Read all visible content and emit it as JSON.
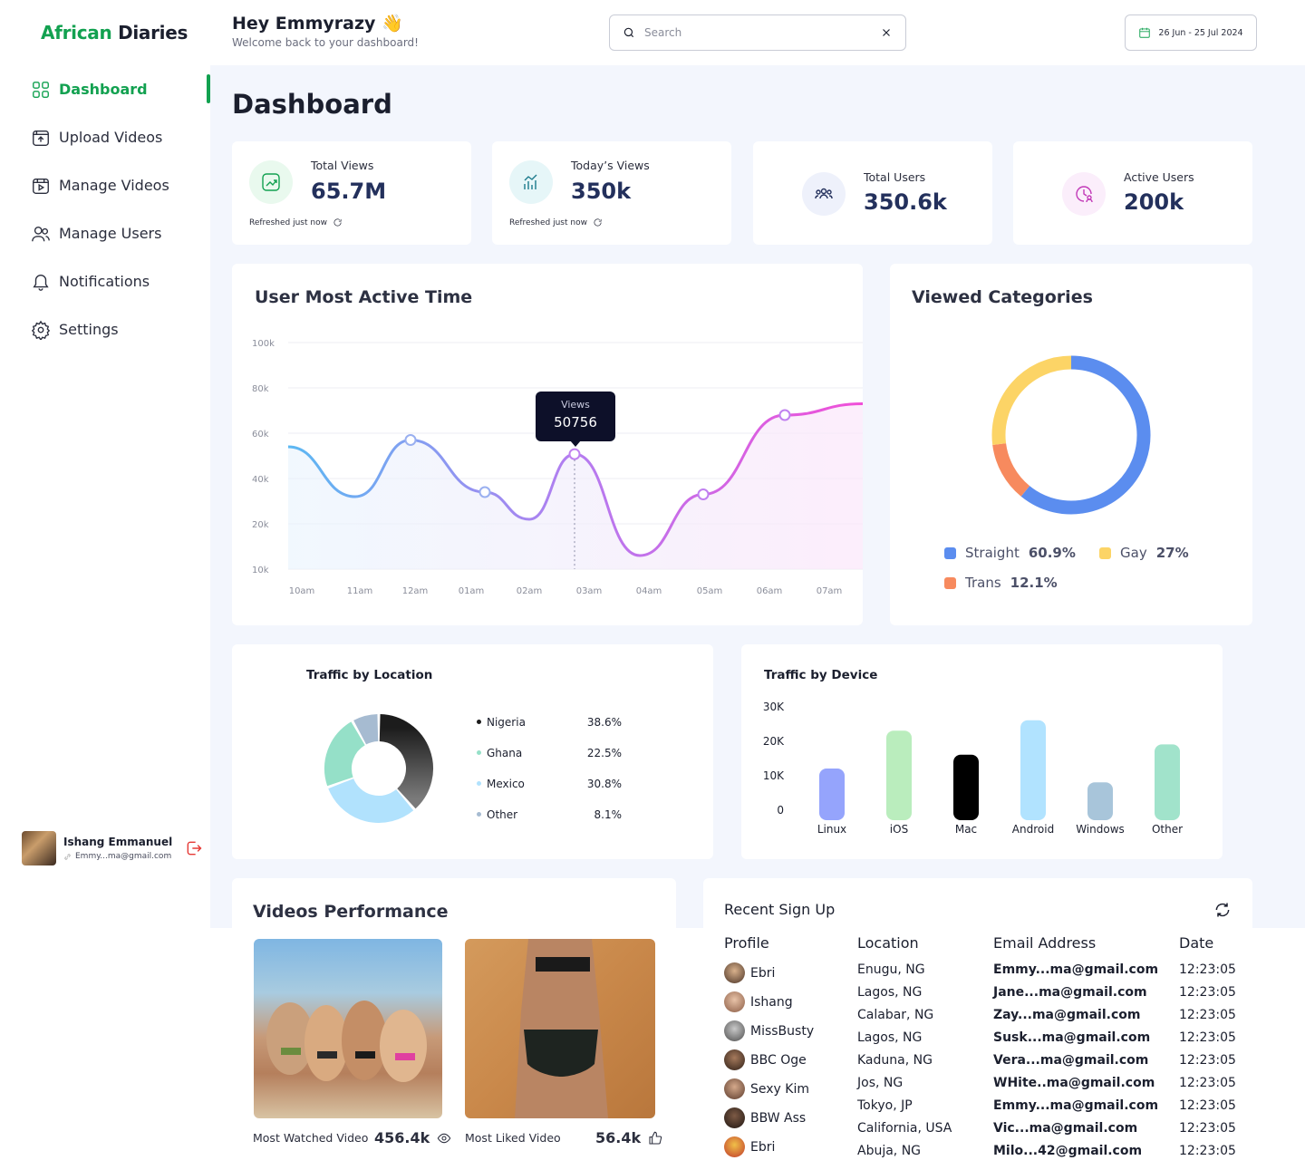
{
  "brand": {
    "part1": "African",
    "part2": "Diaries"
  },
  "header": {
    "greeting": "Hey Emmyrazy 👋",
    "subtitle": "Welcome back to your dashboard!",
    "search_placeholder": "Search",
    "date_range": "26 Jun - 25 Jul 2024"
  },
  "sidebar": {
    "items": [
      {
        "label": "Dashboard",
        "icon": "grid-icon"
      },
      {
        "label": "Upload Videos",
        "icon": "upload-icon"
      },
      {
        "label": "Manage Videos",
        "icon": "video-icon"
      },
      {
        "label": "Manage Users",
        "icon": "users-icon"
      },
      {
        "label": "Notifications",
        "icon": "bell-icon"
      },
      {
        "label": "Settings",
        "icon": "gear-icon"
      }
    ],
    "profile": {
      "name": "Ishang Emmanuel",
      "email": "Emmy...ma@gmail.com"
    }
  },
  "page_title": "Dashboard",
  "stats": [
    {
      "label": "Total Views",
      "value": "65.7M",
      "refresh": "Refreshed just now",
      "color": "#e9f9ee"
    },
    {
      "label": "Today’s Views",
      "value": "350k",
      "refresh": "Refreshed just now",
      "color": "#e6f6f8"
    },
    {
      "label": "Total Users",
      "value": "350.6k",
      "color": "#eef1fb"
    },
    {
      "label": "Active Users",
      "value": "200k",
      "color": "#fbeefb"
    }
  ],
  "active_time": {
    "title": "User Most Active Time",
    "tooltip": {
      "label": "Views",
      "value": "50756"
    },
    "chart_data": {
      "type": "line",
      "title": "User Most Active Time",
      "x": [
        "10am",
        "11am",
        "12am",
        "01am",
        "02am",
        "03am",
        "04am",
        "05am",
        "06am",
        "07am"
      ],
      "y_ticks": [
        "100k",
        "80k",
        "60k",
        "40k",
        "20k",
        "10k"
      ],
      "series": [
        {
          "values": [
            54000,
            32000,
            57000,
            34000,
            22000,
            50756,
            13000,
            33000,
            68000,
            73000
          ]
        }
      ]
    }
  },
  "categories": {
    "title": "Viewed Categories",
    "chart_data": {
      "type": "pie",
      "labels": [
        "Straight",
        "Gay",
        "Trans"
      ],
      "values": [
        60.9,
        27,
        12.1
      ],
      "colors": [
        "#5b8def",
        "#fcd466",
        "#f78a5e"
      ]
    },
    "legend": [
      {
        "name": "Straight",
        "pct": "60.9%"
      },
      {
        "name": "Gay",
        "pct": "27%"
      },
      {
        "name": "Trans",
        "pct": "12.1%"
      }
    ]
  },
  "location": {
    "title": "Traffic by Location",
    "chart_data": {
      "type": "pie",
      "labels": [
        "Nigeria",
        "Ghana",
        "Mexico",
        "Other"
      ],
      "values": [
        38.6,
        22.5,
        30.8,
        8.1
      ],
      "colors": [
        "#1c1c1c",
        "#95e0c8",
        "#b1e2fd",
        "#a6bbd1"
      ]
    },
    "rows": [
      {
        "name": "Nigeria",
        "pct": "38.6%"
      },
      {
        "name": "Ghana",
        "pct": "22.5%"
      },
      {
        "name": "Mexico",
        "pct": "30.8%"
      },
      {
        "name": "Other",
        "pct": "8.1%"
      }
    ]
  },
  "device": {
    "title": "Traffic by Device",
    "chart_data": {
      "type": "bar",
      "categories": [
        "Linux",
        "iOS",
        "Mac",
        "Android",
        "Windows",
        "Other"
      ],
      "values": [
        15000,
        26000,
        19000,
        29000,
        11000,
        22000
      ],
      "y_ticks": [
        "30K",
        "20K",
        "10K",
        "0"
      ],
      "colors": [
        "#95a4fc",
        "#baedbd",
        "#000000",
        "#b1e3ff",
        "#a8c5da",
        "#a1e3cb"
      ]
    }
  },
  "videos": {
    "title": "Videos Performance",
    "most_watched_label": "Most Watched Video",
    "most_watched_count": "456.4k",
    "most_liked_label": "Most Liked Video",
    "most_liked_count": "56.4k"
  },
  "signups": {
    "title": "Recent Sign Up",
    "headers": [
      "Profile",
      "Location",
      "Email Address",
      "Date"
    ],
    "rows": [
      {
        "name": "Ebri",
        "location": "Enugu, NG",
        "email": "Emmy...ma@gmail.com",
        "date": "12:23:05"
      },
      {
        "name": "Ishang",
        "location": "Lagos, NG",
        "email": "Jane...ma@gmail.com",
        "date": "12:23:05"
      },
      {
        "name": "MissBusty",
        "location": "Calabar, NG",
        "email": "Zay...ma@gmail.com",
        "date": "12:23:05"
      },
      {
        "name": "BBC Oge",
        "location": "Lagos, NG",
        "email": "Susk...ma@gmail.com",
        "date": "12:23:05"
      },
      {
        "name": "Sexy Kim",
        "location": "Kaduna, NG",
        "email": "Vera...ma@gmail.com",
        "date": "12:23:05"
      },
      {
        "name": "BBW Ass",
        "location": "Jos, NG",
        "email": "WHite..ma@gmail.com",
        "date": "12:23:05"
      },
      {
        "name": "Ebri",
        "location": "Tokyo, JP",
        "email": "Emmy...ma@gmail.com",
        "date": "12:23:05"
      },
      {
        "name": "",
        "location": "California, USA",
        "email": "Vic...ma@gmail.com",
        "date": "12:23:05"
      },
      {
        "name": "",
        "location": "Abuja, NG",
        "email": "Milo...42@gmail.com",
        "date": "12:23:05"
      }
    ]
  }
}
